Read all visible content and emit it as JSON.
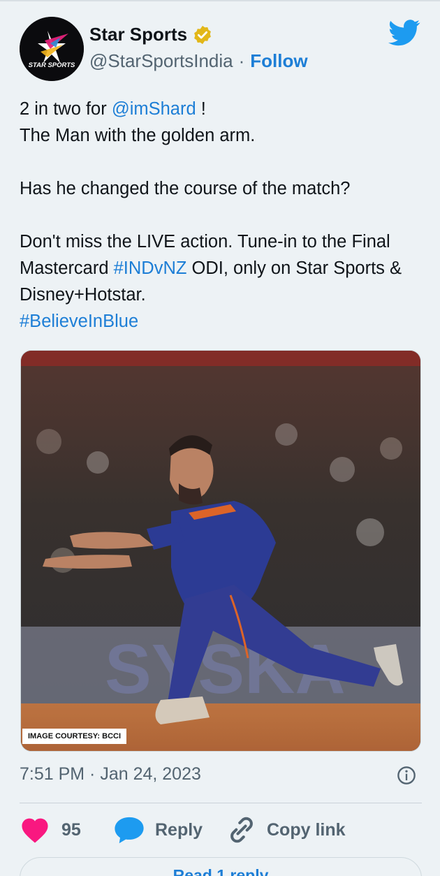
{
  "author": {
    "name": "Star Sports",
    "handle": "@StarSportsIndia",
    "separator": "·",
    "follow_label": "Follow",
    "avatar_text": "STAR SPORTS"
  },
  "tweet": {
    "line1_prefix": "2 in two for ",
    "line1_mention": "@imShard",
    "line1_suffix": " !",
    "line2": "The Man with the golden arm.",
    "line3": "Has he changed the course of the match?",
    "line4_part1": "Don't miss the LIVE action. Tune-in to the Final Mastercard ",
    "line4_hashtag": "#INDvNZ",
    "line4_part2": " ODI, only on Star Sports & Disney+Hotstar.",
    "line5_hashtag": "#BelieveInBlue"
  },
  "media": {
    "courtesy_label": "IMAGE COURTESY: BCCI"
  },
  "meta": {
    "timestamp": "7:51 PM · Jan 24, 2023"
  },
  "actions": {
    "like_count": "95",
    "reply_label": "Reply",
    "copy_link_label": "Copy link"
  },
  "footer": {
    "read_reply_label": "Read 1 reply"
  },
  "colors": {
    "link": "#1d7ed6",
    "like": "#f91880",
    "reply": "#1d9bf0",
    "verified": "#e2b719",
    "twitter_bird": "#1d9bf0",
    "background": "#edf2f5"
  },
  "icons": [
    "verified-badge-icon",
    "twitter-bird-icon",
    "info-icon",
    "heart-icon",
    "speech-bubble-icon",
    "link-icon"
  ]
}
